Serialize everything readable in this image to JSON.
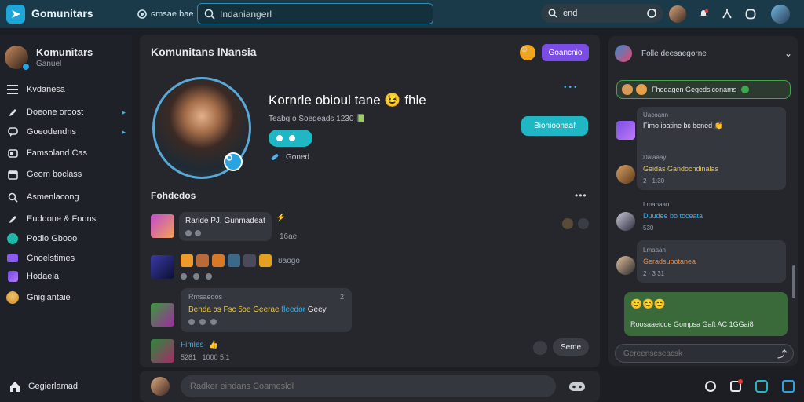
{
  "header": {
    "brand": "Gomunitars",
    "settings_label": "ɢmsae bae",
    "search_placeholder": "Indaniangerl",
    "send_label": "end"
  },
  "sidebar": {
    "profile_name": "Komunitars",
    "profile_sub": "Ganuel",
    "items": [
      {
        "label": "Kvdanesa",
        "icon": "list-icon"
      },
      {
        "label": "Doeone oroost",
        "icon": "pencil-icon",
        "chevron": true
      },
      {
        "label": "Goeodendns",
        "icon": "chat-icon",
        "chevron": true
      },
      {
        "label": "Famsoland Cas",
        "icon": "card-icon"
      },
      {
        "label": "Geom boclass",
        "icon": "calendar-icon"
      },
      {
        "label": "Asmenlacong",
        "icon": "search-icon"
      },
      {
        "label": "Euddone & Foons",
        "icon": "pencil-icon"
      },
      {
        "label": "Podio Gbooo",
        "icon": "globe-icon"
      },
      {
        "label": "Gnoelstimes",
        "icon": "twitch-icon"
      },
      {
        "label": "Hodaela",
        "icon": "badge-icon"
      },
      {
        "label": "Gnigiantaie",
        "icon": "user-icon"
      }
    ],
    "footer_label": "Gegierlamad"
  },
  "main": {
    "title": "Komunitans lNansia",
    "action_button": "Goancnio",
    "profile_name": "Kornrle obioul tane 😉 fhle",
    "profile_meta": "Teabg o Soegeads 1230 📗",
    "follow_button": "Biohioonaaf",
    "sub_label": "Goned",
    "section_title": "Fohdedos",
    "feed": [
      {
        "title": "Raride PJ. Gunmadeat",
        "meta": "16ae",
        "emoji": "⚡"
      },
      {
        "title": "",
        "meta": "ʊaogo",
        "emoji": ""
      },
      {
        "header": "Rmsaedos",
        "title": "Benda ɔs Fsc 5ɔe Geerae",
        "link": "fleedor",
        "tail": "Geey",
        "count": "2"
      },
      {
        "title": "Fimles",
        "meta": "5281   1000 5:1",
        "emoji": "👍"
      }
    ],
    "reply_button": "Seme"
  },
  "composer": {
    "placeholder": "Radker eindans Coameslol"
  },
  "right": {
    "header": "Folle deesaegorne",
    "top_message": "Fhodagen Gegedslconams",
    "messages": [
      {
        "sender": "Uacoann",
        "text": "Fimo ibatine bɛ bened 👏",
        "name": "",
        "meta": ""
      },
      {
        "sender": "Dalaaay",
        "text": "",
        "name": "Geidas Gandocndinalas",
        "meta": "2 · 1:30"
      },
      {
        "sender": "Lmanaan",
        "text": "",
        "name": "Duudee bo toceata",
        "meta": "530"
      },
      {
        "sender": "Lmaaan",
        "text": "",
        "name": "Geradsubotanea",
        "meta": "2 · 3 31"
      }
    ],
    "green_message": "Roosaaeicde Gompsa Gaft AC 1GGai8",
    "green_emoji": "😊😊😊",
    "input_placeholder": "Gereenseseacsk"
  },
  "colors": {
    "accent": "#1fb7c3",
    "purple": "#7a4de6",
    "yellow_text": "#e7c84a",
    "blue_text": "#34b3f0",
    "orange_text": "#f18a3a"
  }
}
